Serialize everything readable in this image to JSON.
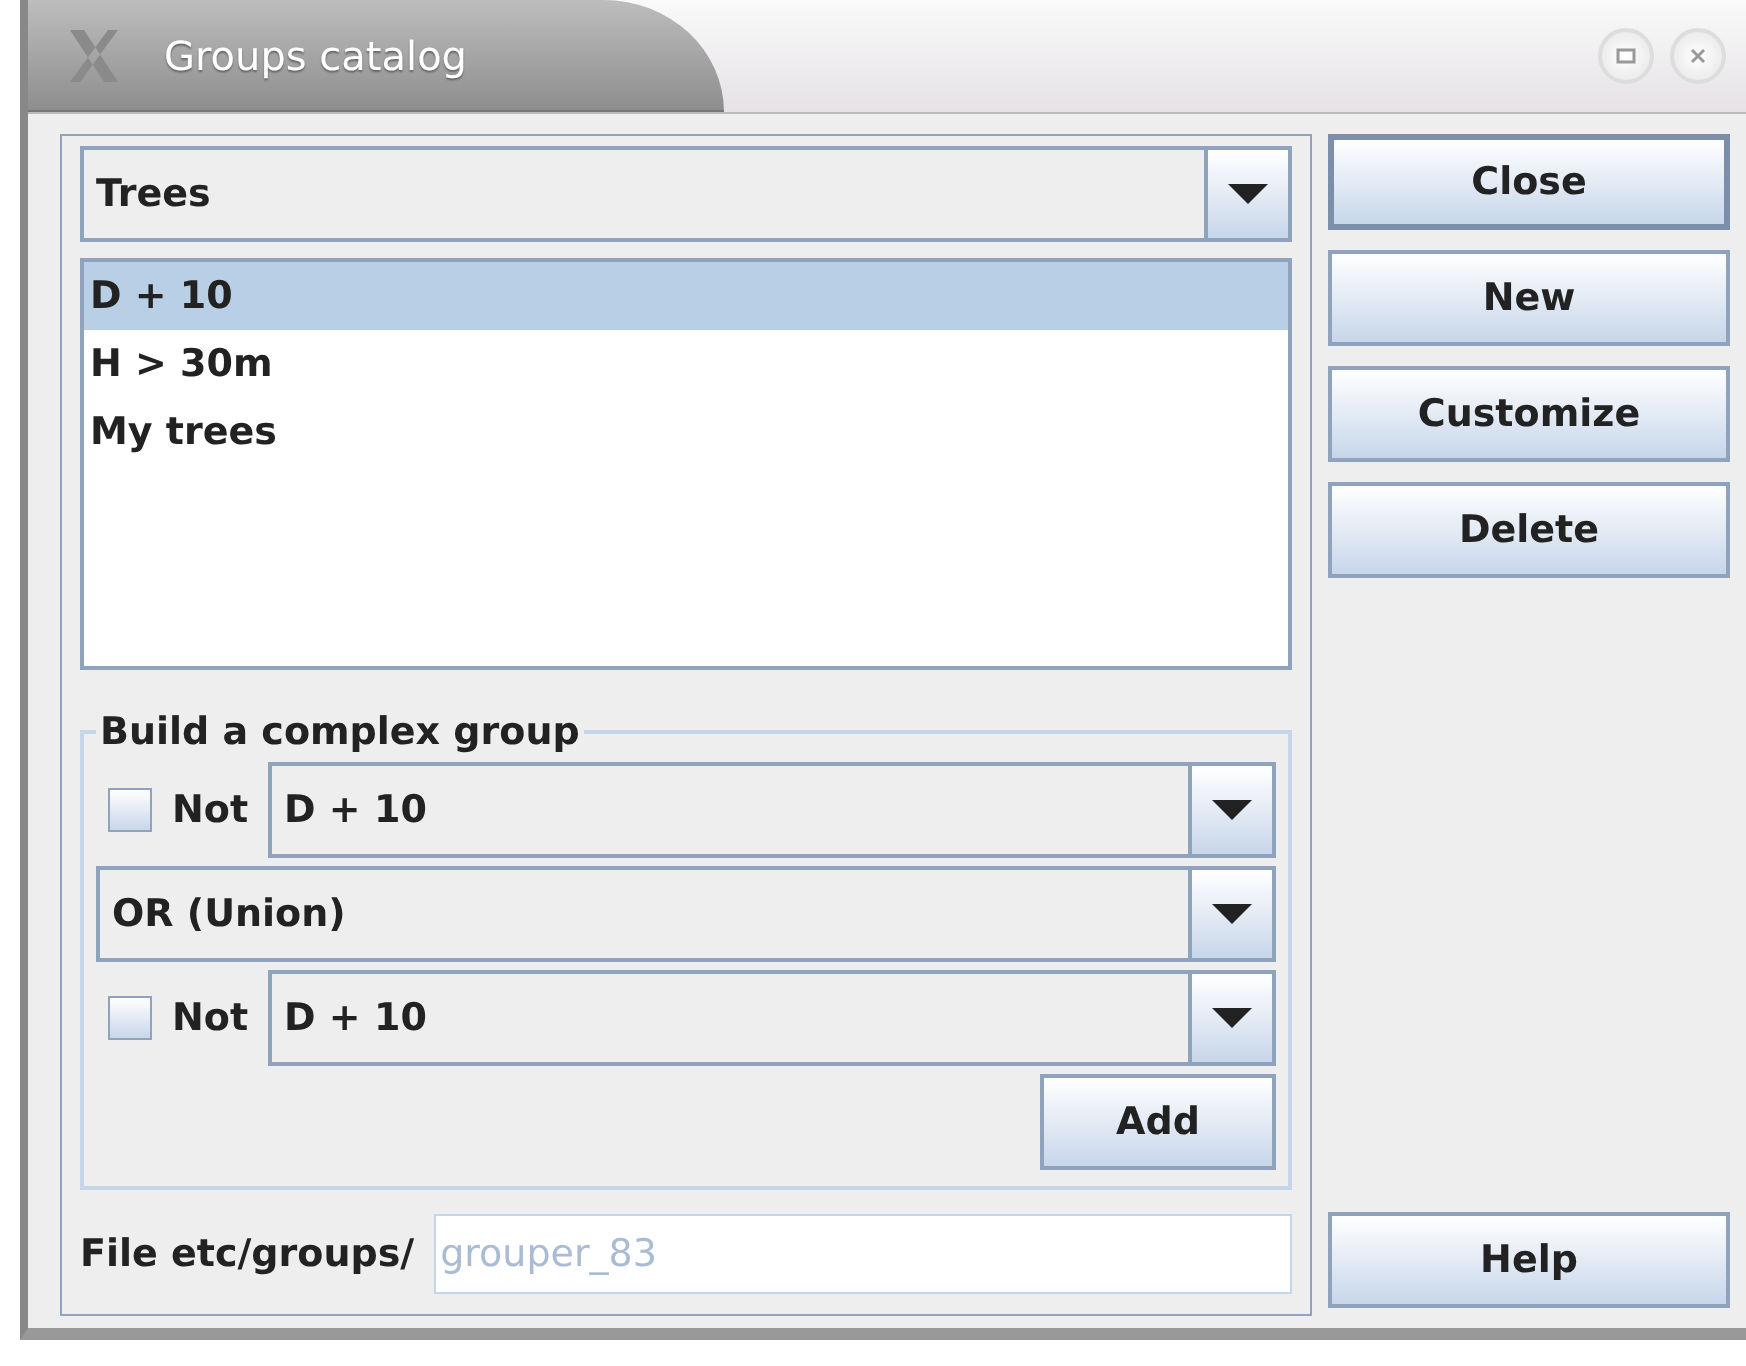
{
  "window": {
    "title": "Groups catalog"
  },
  "category_combo": {
    "value": "Trees"
  },
  "groups": [
    {
      "label": "D + 10",
      "selected": true
    },
    {
      "label": "H > 30m",
      "selected": false
    },
    {
      "label": "My trees",
      "selected": false
    }
  ],
  "complex_group": {
    "title": "Build a complex group",
    "first": {
      "not_label": "Not",
      "checked": false,
      "value": "D + 10"
    },
    "operator": {
      "value": "OR (Union)"
    },
    "second": {
      "not_label": "Not",
      "checked": false,
      "value": "D + 10"
    },
    "add_button": "Add"
  },
  "file": {
    "label": "File etc/groups/",
    "placeholder": "grouper_83"
  },
  "buttons": [
    {
      "label": "Close",
      "default": true
    },
    {
      "label": "New",
      "default": false
    },
    {
      "label": "Customize",
      "default": false
    },
    {
      "label": "Delete",
      "default": false
    }
  ],
  "help_button": "Help"
}
